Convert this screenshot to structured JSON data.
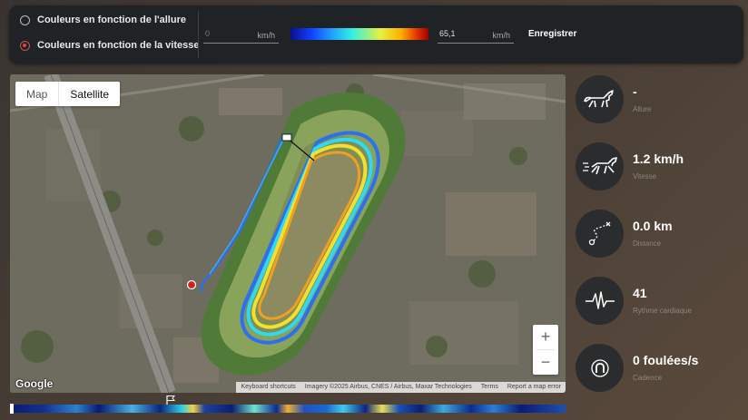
{
  "controls": {
    "radio_pace_label": "Couleurs en fonction de l'allure",
    "radio_speed_label": "Couleurs en fonction de la vitesse",
    "min_value": "0",
    "min_unit": "km/h",
    "max_value": "65,1",
    "max_unit": "km/h",
    "save_label": "Enregistrer",
    "selected_mode": "vitesse"
  },
  "map": {
    "type_map": "Map",
    "type_satellite": "Satellite",
    "active_type": "Satellite",
    "zoom_in": "+",
    "zoom_out": "−",
    "logo": "Google",
    "attribution": {
      "shortcuts": "Keyboard shortcuts",
      "imagery": "Imagery ©2025 Airbus, CNES / Airbus, Maxar Technologies",
      "terms": "Terms",
      "report": "Report a map error"
    }
  },
  "timeline": {
    "progress": 0.0
  },
  "stats": [
    {
      "icon": "horse-icon",
      "value": "-",
      "label": "Allure"
    },
    {
      "icon": "galloping-horse-icon",
      "value": "1.2 km/h",
      "label": "Vitesse"
    },
    {
      "icon": "route-icon",
      "value": "0.0 km",
      "label": "Distance"
    },
    {
      "icon": "heartbeat-icon",
      "value": "41",
      "label": "Rythme cardiaque"
    },
    {
      "icon": "horseshoe-icon",
      "value": "0 foulées/s",
      "label": "Cadence"
    }
  ],
  "colors": {
    "panel": "#1f2326",
    "accent_radio": "#e04840",
    "scale_low": "#0b0f8c",
    "scale_high": "#a00000"
  }
}
